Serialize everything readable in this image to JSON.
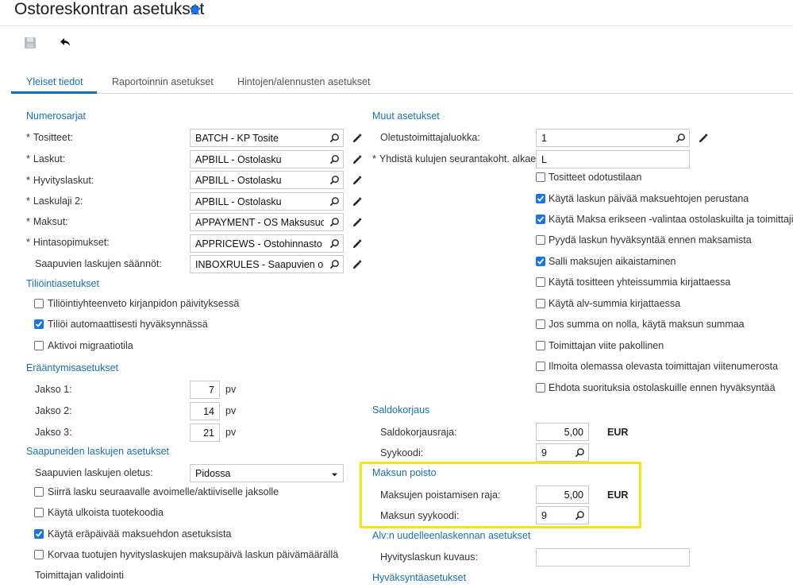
{
  "header": {
    "title": "Ostoreskontran asetukset",
    "favorite_icon": "star-icon"
  },
  "toolbar": {
    "save_icon": "save-icon",
    "undo_icon": "undo-icon"
  },
  "tabs": [
    {
      "label": "Yleiset tiedot",
      "active": true
    },
    {
      "label": "Raportoinnin asetukset",
      "active": false
    },
    {
      "label": "Hintojen/alennusten asetukset",
      "active": false
    }
  ],
  "numbering": {
    "title": "Numerosarjat",
    "rows": [
      {
        "label": "Tositteet:",
        "required": true,
        "value": "BATCH - KP Tosite"
      },
      {
        "label": "Laskut:",
        "required": true,
        "value": "APBILL - Ostolasku"
      },
      {
        "label": "Hyvityslaskut:",
        "required": true,
        "value": "APBILL - Ostolasku"
      },
      {
        "label": "Laskulaji 2:",
        "required": true,
        "value": "APBILL - Ostolasku"
      },
      {
        "label": "Maksut:",
        "required": true,
        "value": "APPAYMENT - OS Maksusuoritus"
      },
      {
        "label": "Hintasopimukset:",
        "required": true,
        "value": "APPRICEWS - Ostohinnasto"
      },
      {
        "label": "Saapuvien laskujen säännöt:",
        "required": false,
        "value": "INBOXRULES - Saapuvien ostolaskujen säännöt"
      }
    ]
  },
  "posting": {
    "title": "Tiliöintiasetukset",
    "items": [
      {
        "label": "Tiliöintiyhteenveto kirjanpidon päivityksessä",
        "checked": false
      },
      {
        "label": "Tiliöi automaattisesti hyväksynnässä",
        "checked": true
      },
      {
        "label": "Aktivoi migraatiotila",
        "checked": false
      }
    ]
  },
  "aging": {
    "title": "Erääntymisasetukset",
    "rows": [
      {
        "label": "Jakso 1:",
        "value": "7",
        "unit": "pv"
      },
      {
        "label": "Jakso 2:",
        "value": "14",
        "unit": "pv"
      },
      {
        "label": "Jakso 3:",
        "value": "21",
        "unit": "pv"
      }
    ]
  },
  "incoming": {
    "title": "Saapuneiden laskujen asetukset",
    "default_label": "Saapuvien laskujen oletus:",
    "default_value": "Pidossa",
    "items": [
      {
        "label": "Siirrä lasku seuraavalle avoimelle/aktiiviselle jaksolle",
        "checked": false
      },
      {
        "label": "Käytä ulkoista tuotekoodia",
        "checked": false
      },
      {
        "label": "Käytä eräpäivää maksuehdon asetuksista",
        "checked": true
      },
      {
        "label": "Korvaa tuotujen hyvityslaskujen maksupäivä laskun päivämäärällä",
        "checked": false
      }
    ],
    "vendor_validation": "Toimittajan validointi"
  },
  "other": {
    "title": "Muut asetukset",
    "vendor_class_label": "Oletustoimittajaluokka:",
    "vendor_class_value": "1",
    "combine_label": "Yhdistä kulujen seurantakoht. alkaen:",
    "combine_value": "L",
    "items": [
      {
        "label": "Tositteet odotustilaan",
        "checked": false
      },
      {
        "label": "Käytä laskun päivää maksuehtojen perustana",
        "checked": true
      },
      {
        "label": "Käytä Maksa erikseen -valintaa ostolaskuilta ja toimittajilta",
        "checked": true
      },
      {
        "label": "Pyydä laskun hyväksyntää ennen maksamista",
        "checked": false
      },
      {
        "label": "Salli maksujen aikaistaminen",
        "checked": true
      },
      {
        "label": "Käytä tositteen yhteissummia kirjattaessa",
        "checked": false
      },
      {
        "label": "Käytä alv-summia kirjattaessa",
        "checked": false
      },
      {
        "label": "Jos summa on nolla, käytä maksun summaa",
        "checked": false
      },
      {
        "label": "Toimittajan viite pakollinen",
        "checked": false
      },
      {
        "label": "Ilmoita olemassa olevasta toimittajan viitenumerosta",
        "checked": false
      },
      {
        "label": "Ehdota suorituksia ostolaskuille ennen hyväksyntää",
        "checked": false
      }
    ]
  },
  "balance": {
    "title": "Saldokorjaus",
    "limit_label": "Saldokorjausraja:",
    "limit_value": "5,00",
    "currency": "EUR",
    "reason_label": "Syykoodi:",
    "reason_value": "9"
  },
  "writeoff": {
    "title": "Maksun poisto",
    "limit_label": "Maksujen poistamisen raja:",
    "limit_value": "5,00",
    "currency": "EUR",
    "reason_label": "Maksun syykoodi:",
    "reason_value": "9"
  },
  "vat": {
    "title": "Alv:n uudelleenlaskennan asetukset",
    "credit_label": "Hyvityslaskun kuvaus:",
    "credit_value": ""
  },
  "approval": {
    "title": "Hyväksyntäasetukset"
  },
  "colors": {
    "accent": "#1a6fb3",
    "checkbox": "#1a73e8",
    "highlight": "#f2e31b"
  }
}
